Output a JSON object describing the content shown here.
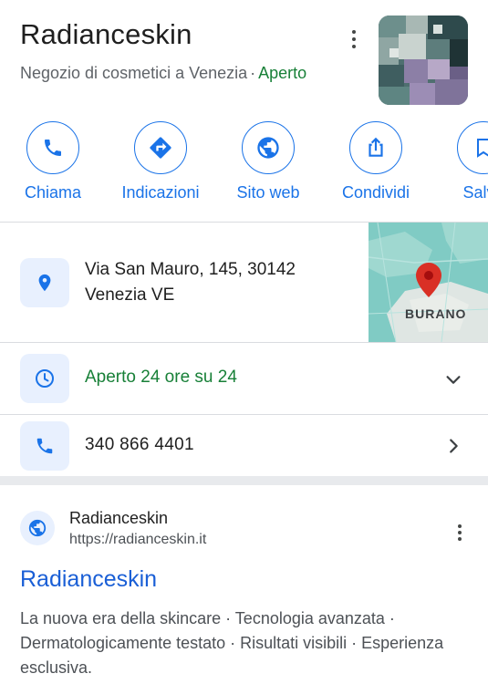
{
  "header": {
    "title": "Radianceskin",
    "category": "Negozio di cosmetici a Venezia",
    "separator": "·",
    "status": "Aperto"
  },
  "actions": [
    {
      "label": "Chiama",
      "icon": "phone-icon"
    },
    {
      "label": "Indicazioni",
      "icon": "directions-icon"
    },
    {
      "label": "Sito web",
      "icon": "globe-icon"
    },
    {
      "label": "Condividi",
      "icon": "share-icon"
    },
    {
      "label": "Salva",
      "icon": "bookmark-icon"
    }
  ],
  "address": {
    "line1": "Via San Mauro, 145, 30142",
    "line2": "Venezia VE",
    "map_label": "BURANO"
  },
  "hours": {
    "text": "Aperto 24 ore su 24"
  },
  "phone": {
    "number": "340 866 4401"
  },
  "result": {
    "site_name": "Radianceskin",
    "url": "https://radianceskin.it",
    "title": "Radianceskin",
    "snippet": "La nuova era della skincare · Tecnologia avanzata · Dermatologicamente testato · Risultati visibili · Esperienza esclusiva."
  },
  "colors": {
    "accent": "#1a73e8",
    "open": "#188038",
    "icon_bg": "#e8f0fe",
    "link": "#1a5fd6"
  }
}
